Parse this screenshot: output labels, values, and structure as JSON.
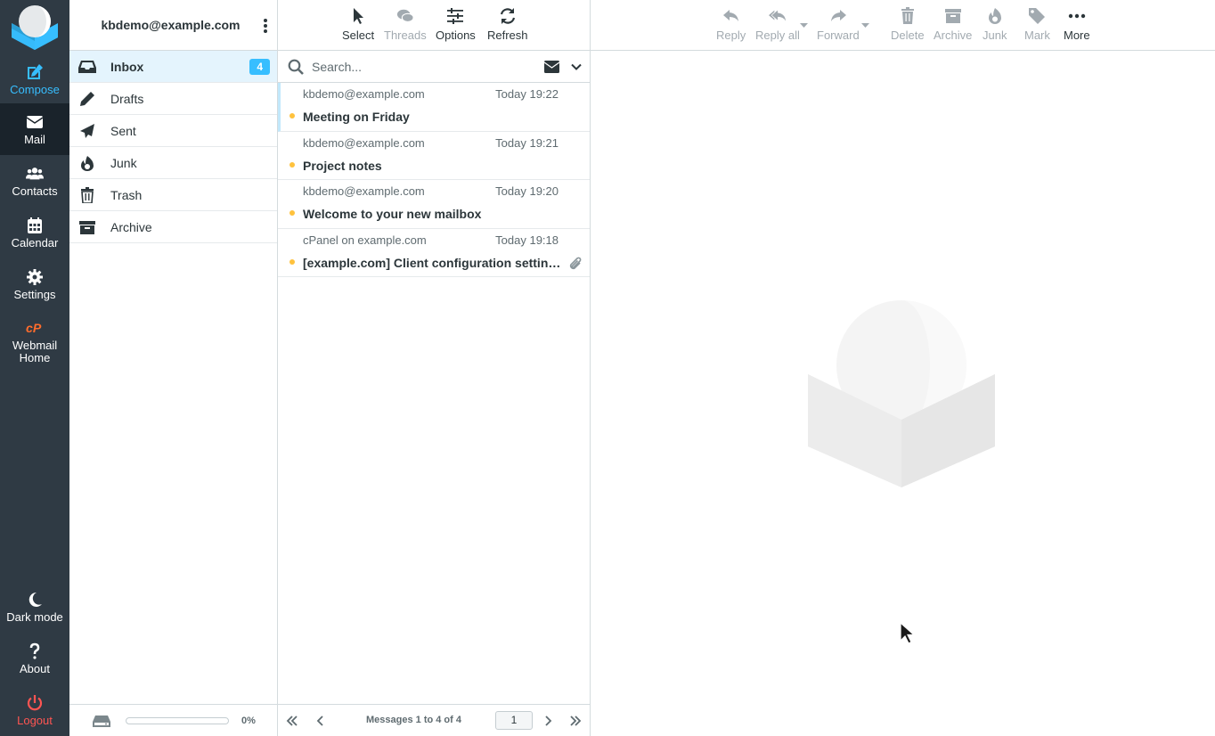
{
  "nav": {
    "compose": "Compose",
    "mail": "Mail",
    "contacts": "Contacts",
    "calendar": "Calendar",
    "settings": "Settings",
    "webmail_home": "Webmail Home",
    "dark_mode": "Dark mode",
    "about": "About",
    "logout": "Logout"
  },
  "folders": {
    "account": "kbdemo@example.com",
    "items": [
      {
        "label": "Inbox",
        "icon": "inbox-icon",
        "unread": "4",
        "selected": true
      },
      {
        "label": "Drafts",
        "icon": "pencil-icon"
      },
      {
        "label": "Sent",
        "icon": "paper-plane-icon"
      },
      {
        "label": "Junk",
        "icon": "fire-icon"
      },
      {
        "label": "Trash",
        "icon": "trash-icon"
      },
      {
        "label": "Archive",
        "icon": "archive-icon"
      }
    ],
    "quota_text": "0%",
    "quota_level": 0
  },
  "list_toolbar": {
    "select": "Select",
    "threads": "Threads",
    "options": "Options",
    "refresh": "Refresh"
  },
  "search": {
    "placeholder": "Search..."
  },
  "messages": [
    {
      "from": "kbdemo@example.com",
      "date": "Today 19:22",
      "subject": "Meeting on Friday",
      "unread": true,
      "attachment": false
    },
    {
      "from": "kbdemo@example.com",
      "date": "Today 19:21",
      "subject": "Project notes",
      "unread": true,
      "attachment": false
    },
    {
      "from": "kbdemo@example.com",
      "date": "Today 19:20",
      "subject": "Welcome to your new mailbox",
      "unread": true,
      "attachment": false
    },
    {
      "from": "cPanel on example.com",
      "date": "Today 19:18",
      "subject": "[example.com] Client configuration settings for “kbdemo@example.com”.",
      "unread": true,
      "attachment": true
    }
  ],
  "pager": {
    "info": "Messages 1 to 4 of 4",
    "page": "1"
  },
  "message_toolbar": {
    "reply": "Reply",
    "reply_all": "Reply all",
    "forward": "Forward",
    "delete": "Delete",
    "archive": "Archive",
    "junk": "Junk",
    "mark": "Mark",
    "more": "More"
  },
  "colors": {
    "navrail": "#2f3a44",
    "accent": "#37beff",
    "unread_dot": "#ffc23d",
    "logout": "#ff5552",
    "selected_folder": "#e4f4fd"
  }
}
